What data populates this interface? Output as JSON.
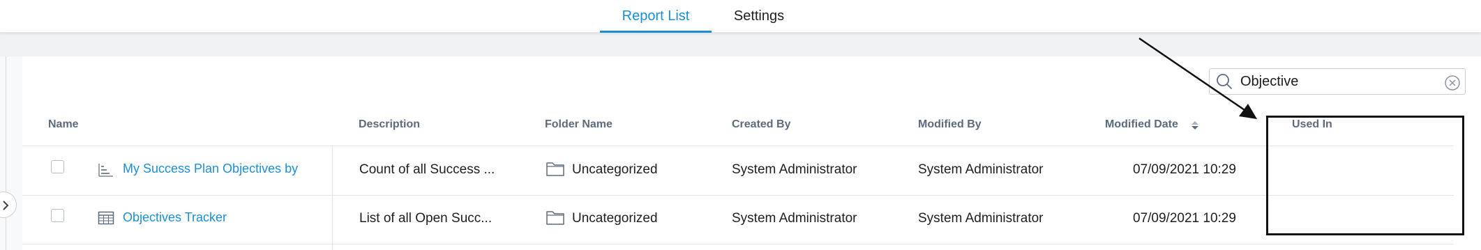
{
  "tabs": [
    {
      "label": "Report List",
      "active": true
    },
    {
      "label": "Settings",
      "active": false
    }
  ],
  "search": {
    "value": "Objective",
    "icon": "search-icon",
    "clear_icon": "close-circle-icon"
  },
  "table": {
    "columns": [
      "Name",
      "Description",
      "Folder Name",
      "Created By",
      "Modified By",
      "Modified Date",
      "Used In"
    ],
    "sort_column": "Modified Date",
    "rows": [
      {
        "name": "My Success Plan Objectives by",
        "type_icon": "bar-chart-icon",
        "description": "Count of all Success ...",
        "folder": "Uncategorized",
        "created_by": "System Administrator",
        "modified_by": "System Administrator",
        "modified_date": "07/09/2021 10:29",
        "used_in": ""
      },
      {
        "name": "Objectives Tracker",
        "type_icon": "table-icon",
        "description": "List of all Open Succ...",
        "folder": "Uncategorized",
        "created_by": "System Administrator",
        "modified_by": "System Administrator",
        "modified_date": "07/09/2021 10:29",
        "used_in": ""
      }
    ]
  },
  "colors": {
    "accent": "#1b8fd6",
    "header_text": "#5d6b7c",
    "annotation": "#111111"
  }
}
